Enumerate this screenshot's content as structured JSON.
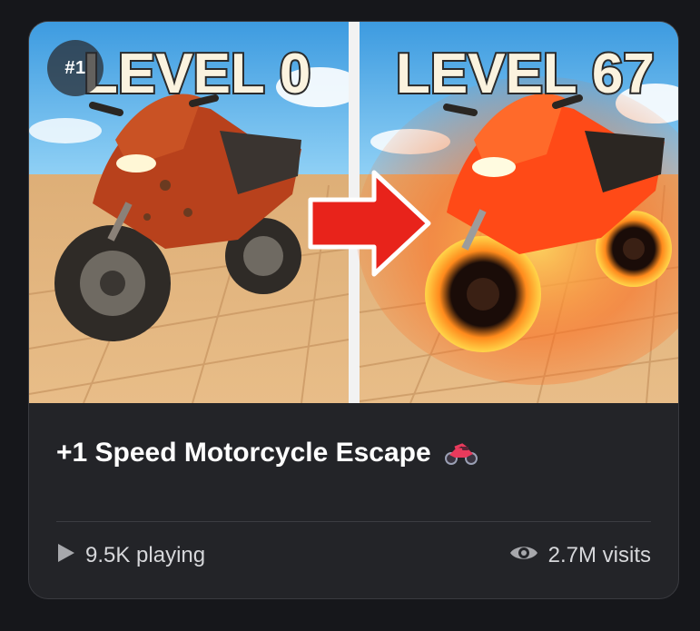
{
  "card": {
    "rank_badge": "#1",
    "thumbnail": {
      "left_panel_text": "LEVEL 0",
      "right_panel_text": "LEVEL 67",
      "accent_colors": {
        "sky": "#5bb4ea",
        "ground": "#e3b27a",
        "title_text": "#fbf3df",
        "title_number": "#f6c23a",
        "arrow": "#e8231b",
        "bike_rusty": "#b8411c",
        "bike_glowing": "#ff4a17"
      }
    },
    "title": "+1 Speed Motorcycle Escape",
    "title_emoji": "motorcycle-emoji",
    "stats": {
      "playing_icon": "play-icon",
      "playing": "9.5K playing",
      "visits_icon": "eye-icon",
      "visits": "2.7M visits"
    },
    "colors": {
      "card_background": "#232428",
      "page_background": "#16171b",
      "text_primary": "#ffffff",
      "text_secondary": "#d6d7da",
      "icon_gray": "#a7a8ac"
    }
  }
}
